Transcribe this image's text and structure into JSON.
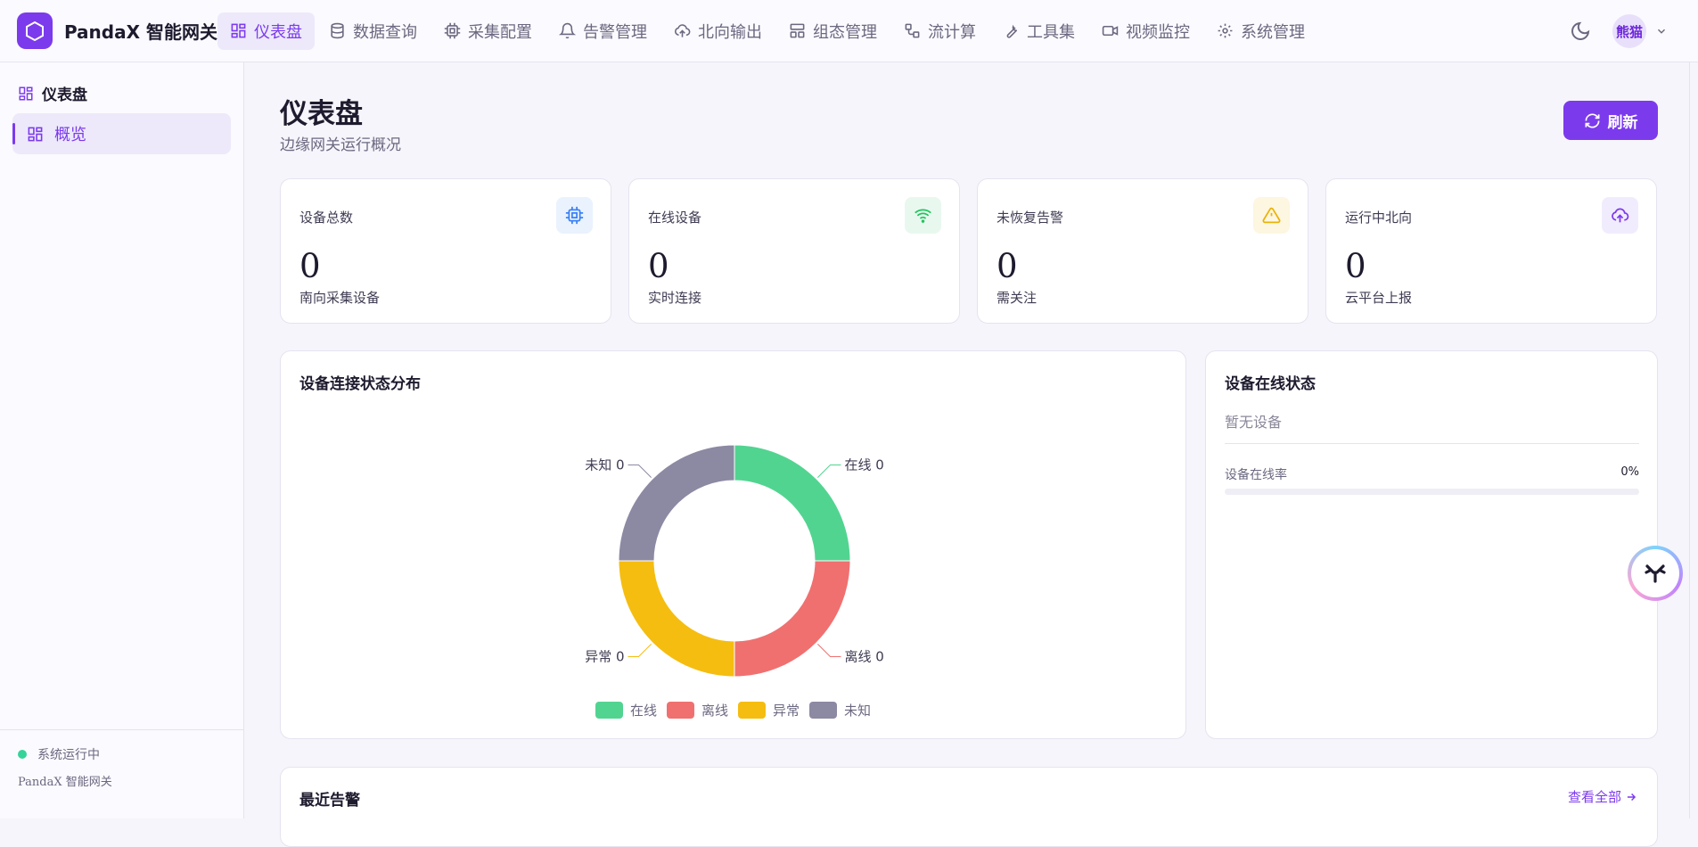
{
  "app": {
    "brand": "PandaX 智能网关"
  },
  "nav": [
    {
      "label": "仪表盘",
      "icon": "dashboard-icon",
      "active": true
    },
    {
      "label": "数据查询",
      "icon": "database-icon"
    },
    {
      "label": "采集配置",
      "icon": "chip-icon"
    },
    {
      "label": "告警管理",
      "icon": "bell-icon"
    },
    {
      "label": "北向输出",
      "icon": "cloud-upload-icon"
    },
    {
      "label": "组态管理",
      "icon": "layout-icon"
    },
    {
      "label": "流计算",
      "icon": "flow-icon"
    },
    {
      "label": "工具集",
      "icon": "wrench-icon"
    },
    {
      "label": "视频监控",
      "icon": "video-icon"
    },
    {
      "label": "系统管理",
      "icon": "gear-icon"
    }
  ],
  "user": {
    "name": "熊猫"
  },
  "sidebar": {
    "section": "仪表盘",
    "items": [
      {
        "label": "概览",
        "active": true
      }
    ],
    "status": "系统运行中",
    "footer": "PandaX 智能网关"
  },
  "page": {
    "title": "仪表盘",
    "subtitle": "边缘网关运行概况",
    "refresh": "刷新"
  },
  "stats": [
    {
      "label": "设备总数",
      "value": "0",
      "desc": "南向采集设备",
      "icon": "chip-icon",
      "color": "#3b82f6",
      "bg": "#eaf2fe"
    },
    {
      "label": "在线设备",
      "value": "0",
      "desc": "实时连接",
      "icon": "wifi-icon",
      "color": "#22c55e",
      "bg": "#e8f8ef"
    },
    {
      "label": "未恢复告警",
      "value": "0",
      "desc": "需关注",
      "icon": "warning-icon",
      "color": "#eab308",
      "bg": "#fdf6e0"
    },
    {
      "label": "运行中北向",
      "value": "0",
      "desc": "云平台上报",
      "icon": "cloud-upload-icon",
      "color": "#7c3aed",
      "bg": "#f1ecfd"
    }
  ],
  "status_panel": {
    "title": "设备连接状态分布"
  },
  "chart_data": {
    "type": "pie",
    "series": [
      {
        "name": "在线",
        "value": 0,
        "color": "#52d491"
      },
      {
        "name": "离线",
        "value": 0,
        "color": "#f07070"
      },
      {
        "name": "异常",
        "value": 0,
        "color": "#f5bd0f"
      },
      {
        "name": "未知",
        "value": 0,
        "color": "#8c89a3"
      }
    ],
    "labels": [
      "在线 0",
      "离线 0",
      "异常 0",
      "未知 0"
    ],
    "legend_position": "bottom"
  },
  "online_panel": {
    "title": "设备在线状态",
    "empty": "暂无设备",
    "rate_label": "设备在线率",
    "rate_value": "0%",
    "rate": 0
  },
  "alerts_panel": {
    "title": "最近告警",
    "view_all": "查看全部"
  }
}
